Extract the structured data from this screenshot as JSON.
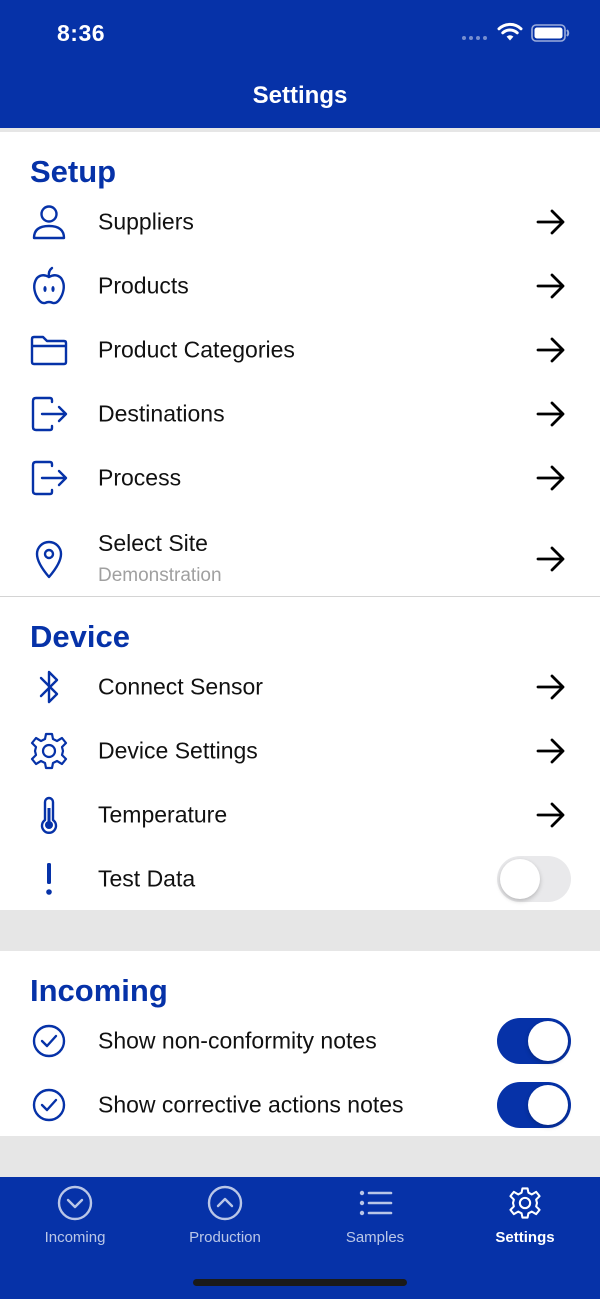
{
  "status_bar": {
    "time": "8:36"
  },
  "header": {
    "title": "Settings"
  },
  "setup": {
    "title": "Setup",
    "items": [
      {
        "label": "Suppliers",
        "icon": "person-icon"
      },
      {
        "label": "Products",
        "icon": "apple-icon"
      },
      {
        "label": "Product Categories",
        "icon": "folder-icon"
      },
      {
        "label": "Destinations",
        "icon": "exit-icon"
      },
      {
        "label": "Process",
        "icon": "exit-icon"
      },
      {
        "label": "Select Site",
        "sublabel": "Demonstration",
        "icon": "location-pin-icon"
      }
    ]
  },
  "device": {
    "title": "Device",
    "items": [
      {
        "label": "Connect Sensor",
        "icon": "bluetooth-icon"
      },
      {
        "label": "Device Settings",
        "icon": "gear-icon"
      },
      {
        "label": "Temperature",
        "icon": "thermometer-icon"
      },
      {
        "label": "Test Data",
        "icon": "exclamation-icon",
        "toggle": false
      }
    ]
  },
  "incoming": {
    "title": "Incoming",
    "items": [
      {
        "label": "Show non-conformity notes",
        "icon": "check-circle-icon",
        "toggle": true
      },
      {
        "label": "Show corrective actions notes",
        "icon": "check-circle-icon",
        "toggle": true
      }
    ]
  },
  "tabbar": {
    "tabs": [
      {
        "label": "Incoming",
        "icon": "chevron-down-circle-icon",
        "active": false
      },
      {
        "label": "Production",
        "icon": "chevron-up-circle-icon",
        "active": false
      },
      {
        "label": "Samples",
        "icon": "list-icon",
        "active": false
      },
      {
        "label": "Settings",
        "icon": "gear-icon",
        "active": true
      }
    ]
  },
  "colors": {
    "brand": "#0632a8",
    "toggle_off": "#e9e9eb",
    "sublabel": "#a0a0a0"
  }
}
